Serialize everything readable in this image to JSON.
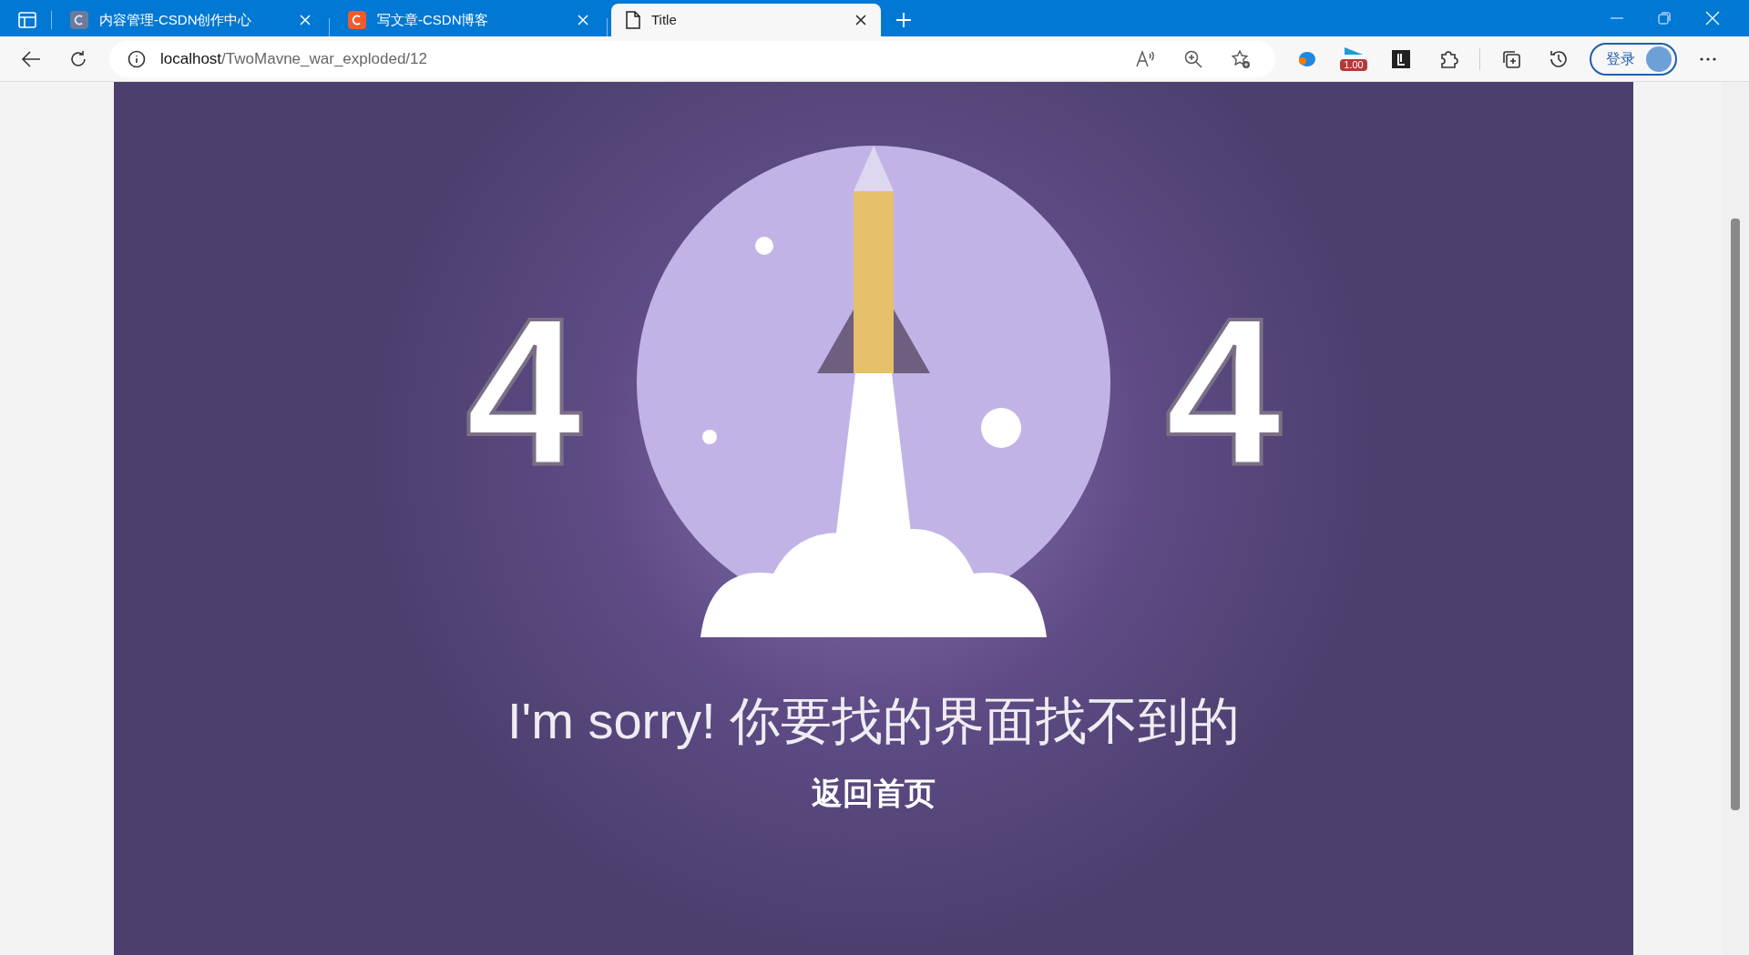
{
  "browser": {
    "tabs": [
      {
        "title": "内容管理-CSDN创作中心",
        "kind": "csdn-grey",
        "selected": false
      },
      {
        "title": "写文章-CSDN博客",
        "kind": "csdn-red",
        "selected": false
      },
      {
        "title": "Title",
        "kind": "page",
        "selected": true
      }
    ],
    "address": {
      "host": "localhost",
      "path": "/TwoMavne_war_exploded/12"
    },
    "extension_badge": "1.00",
    "profile_button": "登录"
  },
  "page": {
    "digits": [
      "4",
      "4"
    ],
    "message": "I'm sorry! 你要找的界面找不到的",
    "home_link": "返回首页"
  }
}
